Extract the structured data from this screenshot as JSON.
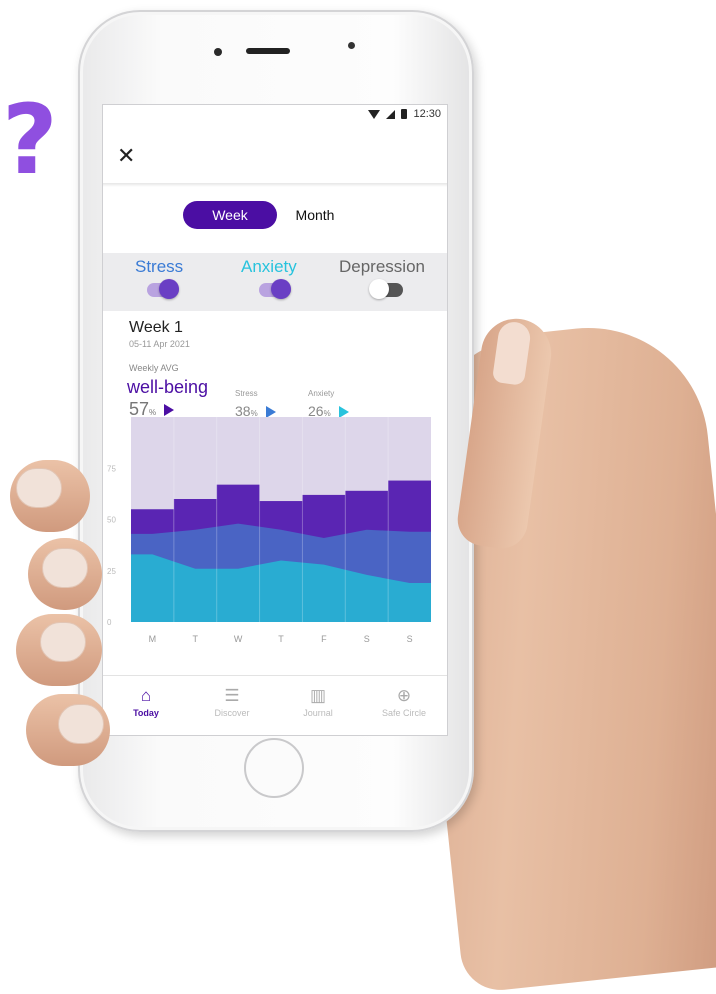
{
  "decor": {
    "question_mark": "?"
  },
  "status": {
    "time": "12:30"
  },
  "header": {
    "close_icon": "close-icon"
  },
  "period": {
    "week_label": "Week",
    "month_label": "Month",
    "selected": "Week"
  },
  "toggles": [
    {
      "label": "Stress",
      "on": true,
      "color": "#3a7bd5"
    },
    {
      "label": "Anxiety",
      "on": true,
      "color": "#28c3dd"
    },
    {
      "label": "Depression",
      "on": false,
      "color": "#666666"
    }
  ],
  "summary": {
    "week_title": "Week 1",
    "week_dates": "05-11 Apr 2021",
    "weekly_avg_label": "Weekly AVG",
    "wellbeing_label": "well-being",
    "wellbeing_value": "57",
    "stress_label": "Stress",
    "stress_value": "38",
    "anxiety_label": "Anxiety",
    "anxiety_value": "26",
    "unit": "%"
  },
  "chart_data": {
    "type": "area",
    "x": [
      "M",
      "T",
      "W",
      "T",
      "F",
      "S",
      "S"
    ],
    "y_ticks": [
      0,
      25,
      50,
      75
    ],
    "ylim": [
      0,
      100
    ],
    "series": [
      {
        "values": [
          55,
          60,
          67,
          59,
          62,
          64,
          69
        ]
      },
      {
        "values": [
          43,
          45,
          48,
          45,
          41,
          45,
          44
        ]
      },
      {
        "values": [
          33,
          26,
          26,
          30,
          28,
          23,
          19
        ]
      }
    ],
    "colors": {
      "background": "#ddd6ea",
      "wellbeing": "#5a25b3",
      "stress": "#4a64c4",
      "anxiety": "#29acd2"
    },
    "grid": false
  },
  "tabs": [
    {
      "label": "Today",
      "icon": "home-icon",
      "glyph": "⌂",
      "active": true
    },
    {
      "label": "Discover",
      "icon": "list-icon",
      "glyph": "☰",
      "active": false
    },
    {
      "label": "Journal",
      "icon": "book-icon",
      "glyph": "▥",
      "active": false
    },
    {
      "label": "Safe Circle",
      "icon": "safe-circle-icon",
      "glyph": "⊕",
      "active": false
    }
  ]
}
